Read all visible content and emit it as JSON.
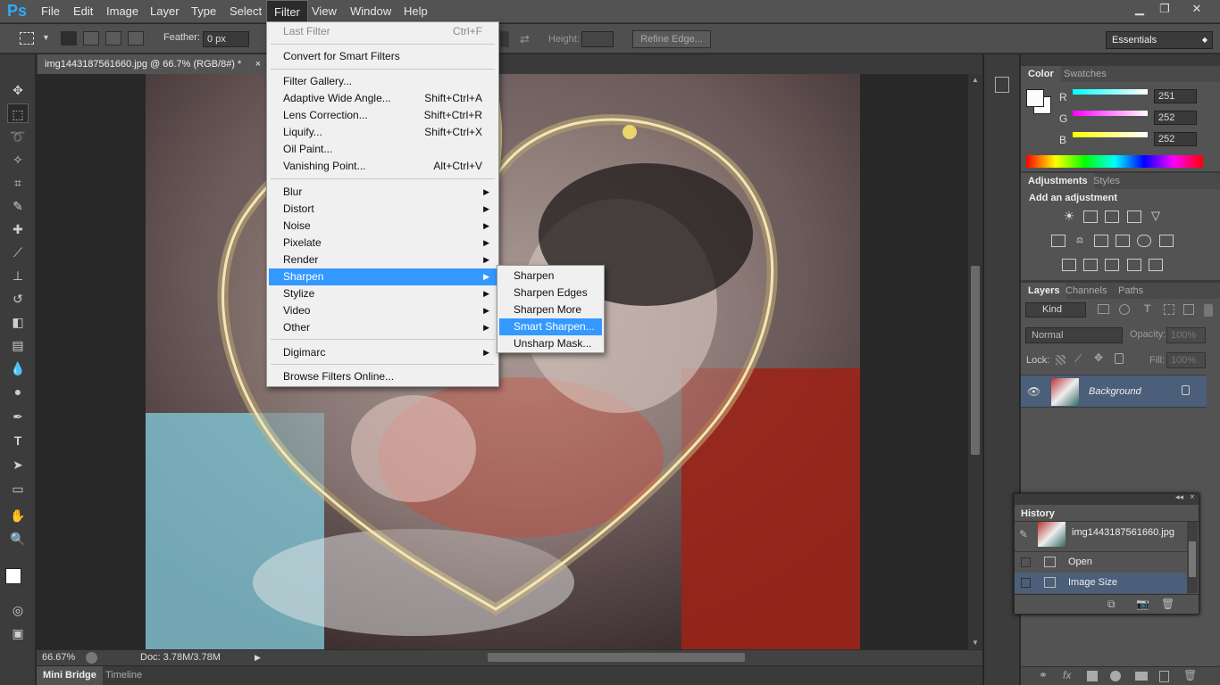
{
  "app": {
    "logo": "Ps"
  },
  "menubar": {
    "items": [
      "File",
      "Edit",
      "Image",
      "Layer",
      "Type",
      "Select",
      "Filter",
      "View",
      "Window",
      "Help"
    ],
    "active": "Filter"
  },
  "window_controls": {
    "minimize": "▁",
    "restore": "❐",
    "close": "✕"
  },
  "options": {
    "feather_label": "Feather:",
    "feather_value": "0 px",
    "height_label": "Height:",
    "refine_edge": "Refine Edge...",
    "workspace": "Essentials"
  },
  "document": {
    "tab_title": "img1443187561660.jpg @ 66.7% (RGB/8#) *",
    "close": "×"
  },
  "status": {
    "zoom": "66.67%",
    "doc_size": "Doc: 3.78M/3.78M"
  },
  "bottom_tabs": [
    "Mini Bridge",
    "Timeline"
  ],
  "filter_menu": {
    "last_filter": {
      "label": "Last Filter",
      "shortcut": "Ctrl+F"
    },
    "convert": "Convert for Smart Filters",
    "group1": [
      {
        "label": "Filter Gallery...",
        "shortcut": ""
      },
      {
        "label": "Adaptive Wide Angle...",
        "shortcut": "Shift+Ctrl+A"
      },
      {
        "label": "Lens Correction...",
        "shortcut": "Shift+Ctrl+R"
      },
      {
        "label": "Liquify...",
        "shortcut": "Shift+Ctrl+X"
      },
      {
        "label": "Oil Paint...",
        "shortcut": ""
      },
      {
        "label": "Vanishing Point...",
        "shortcut": "Alt+Ctrl+V"
      }
    ],
    "group2": [
      "Blur",
      "Distort",
      "Noise",
      "Pixelate",
      "Render",
      "Sharpen",
      "Stylize",
      "Video",
      "Other"
    ],
    "highlighted": "Sharpen",
    "digimarc": "Digimarc",
    "browse": "Browse Filters Online..."
  },
  "sharpen_submenu": {
    "items": [
      "Sharpen",
      "Sharpen Edges",
      "Sharpen More",
      "Smart Sharpen...",
      "Unsharp Mask..."
    ],
    "highlighted": "Smart Sharpen..."
  },
  "color_panel": {
    "tabs": [
      "Color",
      "Swatches"
    ],
    "channels": [
      {
        "label": "R",
        "value": "251",
        "color": "#00e5e5"
      },
      {
        "label": "G",
        "value": "252",
        "color": "#e500e5"
      },
      {
        "label": "B",
        "value": "252",
        "color": "#e5e500"
      }
    ]
  },
  "adjustments_panel": {
    "tabs": [
      "Adjustments",
      "Styles"
    ],
    "heading": "Add an adjustment"
  },
  "layers_panel": {
    "tabs": [
      "Layers",
      "Channels",
      "Paths"
    ],
    "kind": "Kind",
    "blend": "Normal",
    "opacity_label": "Opacity:",
    "opacity_value": "100%",
    "lock_label": "Lock:",
    "fill_label": "Fill:",
    "fill_value": "100%",
    "layer_name": "Background"
  },
  "history_panel": {
    "title": "History",
    "snapshot": "img1443187561660.jpg",
    "states": [
      "Open",
      "Image Size"
    ]
  }
}
